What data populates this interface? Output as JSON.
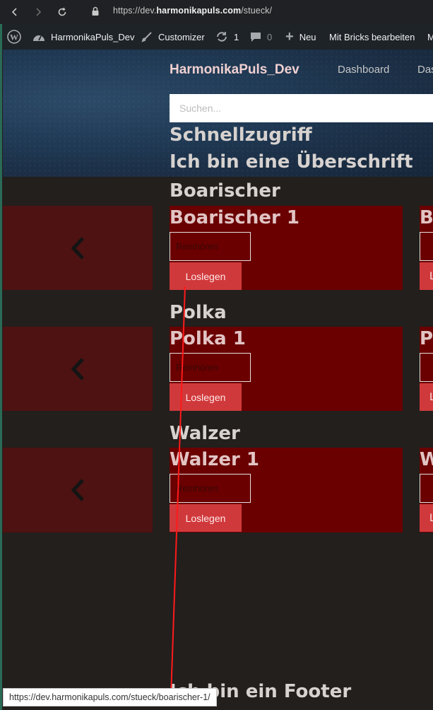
{
  "browser": {
    "url_prefix": "https://dev.",
    "url_domain": "harmonikapuls.com",
    "url_path": "/stueck/",
    "status_url": "https://dev.harmonikapuls.com/stueck/boarischer-1/"
  },
  "admin_bar": {
    "site_name": "HarmonikaPuls_Dev",
    "customizer": "Customizer",
    "updates_count": "1",
    "comments_count": "0",
    "new_label": "Neu",
    "bricks_label": "Mit Bricks bearbeiten",
    "overflow_letter": "M"
  },
  "header": {
    "site_title": "HarmonikaPuls_Dev",
    "nav": [
      "Dashboard",
      "Das"
    ],
    "search_placeholder": "Suchen..."
  },
  "headings": {
    "quick_access": "Schnellzugriff",
    "sample_heading": "Ich bin eine Überschrift"
  },
  "sections": [
    {
      "title": "Boarischer",
      "card_title": "Boarischer 1",
      "listen_label": "Reinhören",
      "button_label": "Loslegen",
      "edge_letter": "B",
      "edge_button_letter": "L"
    },
    {
      "title": "Polka",
      "card_title": "Polka 1",
      "listen_label": "Reinhören",
      "button_label": "Loslegen",
      "edge_letter": "P",
      "edge_button_letter": "L"
    },
    {
      "title": "Walzer",
      "card_title": "Walzer 1",
      "listen_label": "Reinhören",
      "button_label": "Loslegen",
      "edge_letter": "W",
      "edge_button_letter": "L"
    }
  ],
  "footer": {
    "heading": "Ich bin ein Footer"
  },
  "colors": {
    "card": "#6a0000",
    "card_prev": "#4e1212",
    "button": "#d0393b",
    "page_bg": "#221f1d",
    "annotation_arrow": "#ff1a1a"
  }
}
